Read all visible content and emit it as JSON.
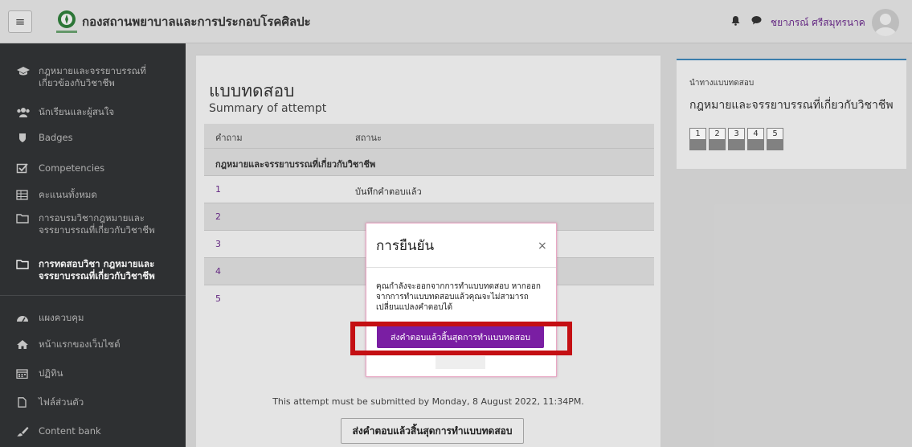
{
  "header": {
    "site_title": "กองสถานพยาบาลและการประกอบโรคศิลปะ",
    "user_name": "ชยาภรณ์ ศรีสมุทรนาค",
    "menu_icon": "hamburger-icon",
    "icons": [
      "bell-icon",
      "chat-icon"
    ]
  },
  "sidebar": {
    "items": [
      {
        "label": "กฎหมายและจรรยาบรรณที่เกี่ยวข้องกับวิชาชีพ",
        "icon": "graduation-cap-icon"
      },
      {
        "label": "นักเรียนและผู้สนใจ",
        "icon": "users-icon"
      },
      {
        "label": "Badges",
        "icon": "shield-icon"
      },
      {
        "label": "Competencies",
        "icon": "checkbox-icon"
      },
      {
        "label": "คะแนนทั้งหมด",
        "icon": "table-icon"
      },
      {
        "label": "การอบรมวิชากฎหมายและจรรยาบรรณที่เกี่ยวกับวิชาชีพ",
        "icon": "folder-icon"
      },
      {
        "label": "การทดสอบวิชา กฎหมายและจรรยาบรรณที่เกี่ยวกับวิชาชีพ",
        "icon": "folder-icon"
      },
      {
        "label": "แผงควบคุม",
        "icon": "dashboard-icon"
      },
      {
        "label": "หน้าแรกของเว็บไซต์",
        "icon": "home-icon"
      },
      {
        "label": "ปฏิทิน",
        "icon": "calendar-icon"
      },
      {
        "label": "ไฟล์ส่วนตัว",
        "icon": "file-icon"
      },
      {
        "label": "Content bank",
        "icon": "paint-brush-icon"
      }
    ]
  },
  "main": {
    "title": "แบบทดสอบ",
    "subtitle": "Summary of attempt",
    "table": {
      "headers": [
        "คำถาม",
        "สถานะ"
      ],
      "section": "กฎหมายและจรรยาบรรณที่เกี่ยวกับวิชาชีพ",
      "rows": [
        {
          "q": "1",
          "status": "บันทึกคำตอบแล้ว"
        },
        {
          "q": "2",
          "status": ""
        },
        {
          "q": "3",
          "status": ""
        },
        {
          "q": "4",
          "status": ""
        },
        {
          "q": "5",
          "status": ""
        }
      ]
    },
    "deadline": "This attempt must be submitted by Monday, 8 August 2022, 11:34PM.",
    "submit_label": "ส่งคำตอบแล้วสิ้นสุดการทำแบบทดสอบ"
  },
  "quiz_nav": {
    "title": "นำทางแบบทดสอบ",
    "heading": "กฎหมายและจรรยาบรรณที่เกี่ยวกับวิชาชีพ",
    "questions": [
      "1",
      "2",
      "3",
      "4",
      "5"
    ]
  },
  "modal": {
    "title": "การยืนยัน",
    "close": "×",
    "body": "คุณกำลังจะออกจากการทำแบบทดสอบ หากออกจากการทำแบบทดสอบแล้วคุณจะไม่สามารถเปลี่ยนแปลงคำตอบได้",
    "submit_label": "ส่งคำตอบแล้วสิ้นสุดการทำแบบทดสอบ"
  },
  "colors": {
    "accent": "#7a1ea3",
    "link": "#6a2b8a",
    "highlight": "#c40f13",
    "sidebar": "#313335"
  }
}
